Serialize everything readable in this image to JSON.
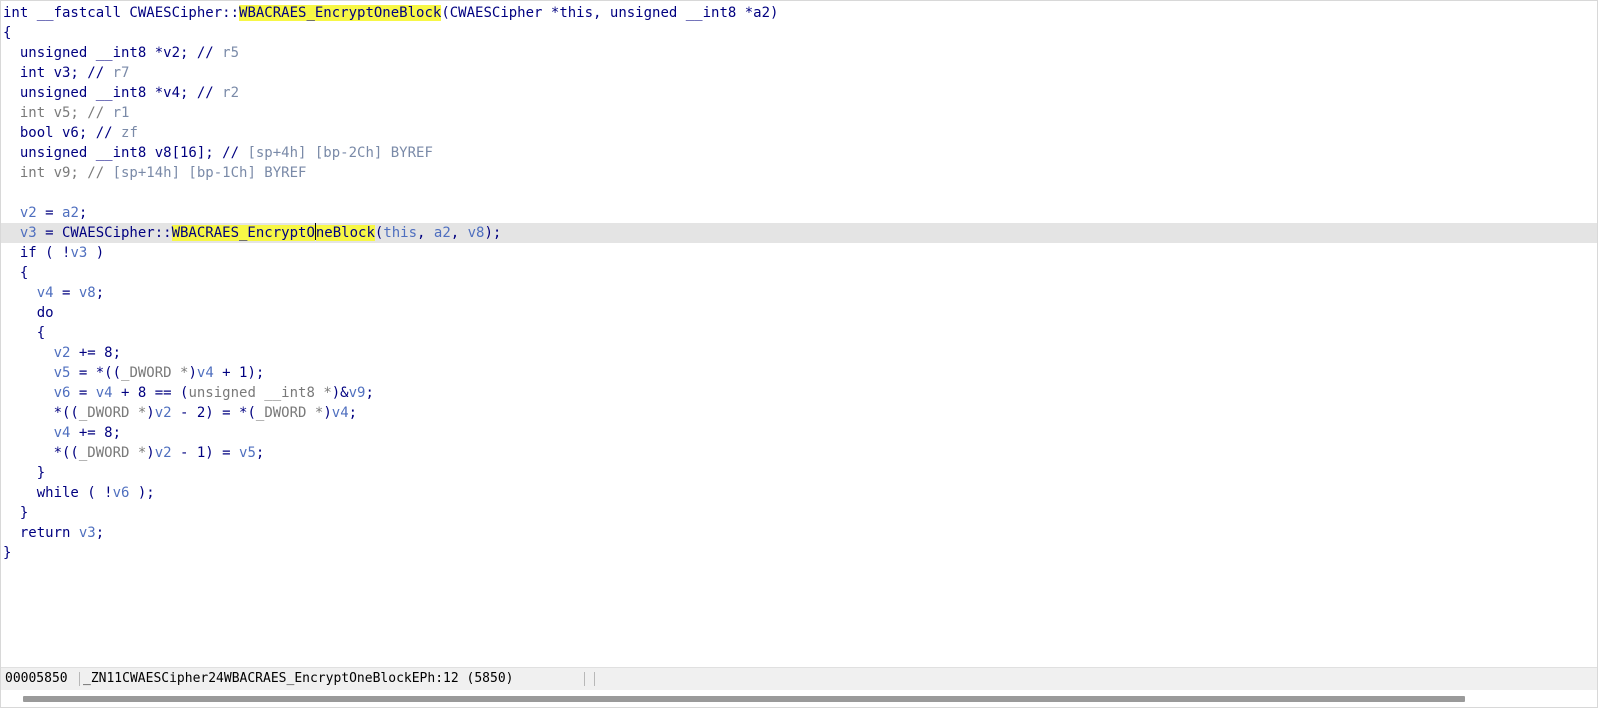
{
  "code_lines": [
    [
      [
        "t-c",
        "int __fastcall CWAESCipher::"
      ],
      [
        "t-hl",
        "WBACRAES_EncryptOneBlock"
      ],
      [
        "t-c",
        "(CWAESCipher *this, unsigned __int8 *a2)"
      ]
    ],
    [
      [
        "t-c",
        "{"
      ]
    ],
    [
      [
        "t-c",
        "  unsigned __int8 *v2; // "
      ],
      [
        "t-cm",
        "r5"
      ]
    ],
    [
      [
        "t-c",
        "  int v3; // "
      ],
      [
        "t-cm",
        "r7"
      ]
    ],
    [
      [
        "t-c",
        "  unsigned __int8 *v4; // "
      ],
      [
        "t-cm",
        "r2"
      ]
    ],
    [
      [
        "t-g",
        "  int v5; // "
      ],
      [
        "t-cm",
        "r1"
      ]
    ],
    [
      [
        "t-c",
        "  bool v6; // "
      ],
      [
        "t-cm",
        "zf"
      ]
    ],
    [
      [
        "t-c",
        "  unsigned __int8 v8[16]; // "
      ],
      [
        "t-cm",
        "[sp+4h] [bp-2Ch] BYREF"
      ]
    ],
    [
      [
        "t-g",
        "  int v9; // "
      ],
      [
        "t-cm",
        "[sp+14h] [bp-1Ch] BYREF"
      ]
    ],
    [],
    [
      [
        "t-v",
        "  v2"
      ],
      [
        "t-c",
        " = "
      ],
      [
        "t-v",
        "a2"
      ],
      [
        "t-c",
        ";"
      ]
    ],
    [
      [
        "t-v",
        "  v3"
      ],
      [
        "t-c",
        " = CWAESCipher::"
      ],
      [
        "t-hl",
        "WBACRAES_EncryptO"
      ],
      [
        "cursor",
        ""
      ],
      [
        "t-hl",
        "neBlock"
      ],
      [
        "t-c",
        "("
      ],
      [
        "t-v",
        "this"
      ],
      [
        "t-c",
        ", "
      ],
      [
        "t-v",
        "a2"
      ],
      [
        "t-c",
        ", "
      ],
      [
        "t-v",
        "v8"
      ],
      [
        "t-c",
        ");"
      ]
    ],
    [
      [
        "t-c",
        "  if ( !"
      ],
      [
        "t-v",
        "v3"
      ],
      [
        "t-c",
        " )"
      ]
    ],
    [
      [
        "t-c",
        "  {"
      ]
    ],
    [
      [
        "t-v",
        "    v4"
      ],
      [
        "t-c",
        " = "
      ],
      [
        "t-v",
        "v8"
      ],
      [
        "t-c",
        ";"
      ]
    ],
    [
      [
        "t-c",
        "    do"
      ]
    ],
    [
      [
        "t-c",
        "    {"
      ]
    ],
    [
      [
        "t-v",
        "      v2"
      ],
      [
        "t-c",
        " += 8;"
      ]
    ],
    [
      [
        "t-v",
        "      v5"
      ],
      [
        "t-c",
        " = *(("
      ],
      [
        "t-g",
        "_DWORD *"
      ],
      [
        "t-c",
        ")"
      ],
      [
        "t-v",
        "v4"
      ],
      [
        "t-c",
        " + 1);"
      ]
    ],
    [
      [
        "t-v",
        "      v6"
      ],
      [
        "t-c",
        " = "
      ],
      [
        "t-v",
        "v4"
      ],
      [
        "t-c",
        " + 8 == ("
      ],
      [
        "t-g",
        "unsigned __int8 *"
      ],
      [
        "t-c",
        ")&"
      ],
      [
        "t-v",
        "v9"
      ],
      [
        "t-c",
        ";"
      ]
    ],
    [
      [
        "t-c",
        "      *(("
      ],
      [
        "t-g",
        "_DWORD *"
      ],
      [
        "t-c",
        ")"
      ],
      [
        "t-v",
        "v2"
      ],
      [
        "t-c",
        " - 2) = *("
      ],
      [
        "t-g",
        "_DWORD *"
      ],
      [
        "t-c",
        ")"
      ],
      [
        "t-v",
        "v4"
      ],
      [
        "t-c",
        ";"
      ]
    ],
    [
      [
        "t-v",
        "      v4"
      ],
      [
        "t-c",
        " += 8;"
      ]
    ],
    [
      [
        "t-c",
        "      *(("
      ],
      [
        "t-g",
        "_DWORD *"
      ],
      [
        "t-c",
        ")"
      ],
      [
        "t-v",
        "v2"
      ],
      [
        "t-c",
        " - 1) = "
      ],
      [
        "t-v",
        "v5"
      ],
      [
        "t-c",
        ";"
      ]
    ],
    [
      [
        "t-c",
        "    }"
      ]
    ],
    [
      [
        "t-c",
        "    while ( !"
      ],
      [
        "t-v",
        "v6"
      ],
      [
        "t-c",
        " );"
      ]
    ],
    [
      [
        "t-c",
        "  }"
      ]
    ],
    [
      [
        "t-c",
        "  return "
      ],
      [
        "t-v",
        "v3"
      ],
      [
        "t-c",
        ";"
      ]
    ],
    [
      [
        "t-c",
        "}"
      ]
    ]
  ],
  "current_line_index": 11,
  "status": {
    "address": "00005850",
    "location": "_ZN11CWAESCipher24WBACRAES_EncryptOneBlockEPh:12 (5850)"
  }
}
